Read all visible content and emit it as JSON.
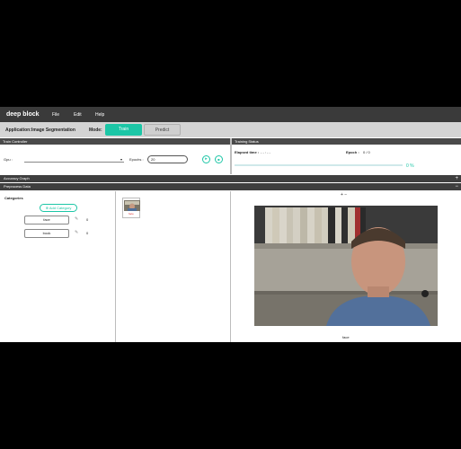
{
  "app": {
    "brand": "deep block",
    "menu": [
      "File",
      "Edit",
      "Help"
    ]
  },
  "modebar": {
    "application_label": "Application:",
    "application_value": "Image Segmentation",
    "mode_label": "Mode:",
    "train_label": "Train",
    "predict_label": "Predict"
  },
  "train_controller": {
    "title": "Train Controller",
    "gpu_label": "Gpu :",
    "epochs_label": "Epochs :",
    "epochs_value": "20"
  },
  "training_status": {
    "title": "Training Status",
    "elapsed_label": "Elapsed time :",
    "elapsed_value": "- - : - -",
    "epoch_label": "Epoch :",
    "epoch_value": "0 / 0",
    "progress_text": "0 %",
    "progress_value": 0
  },
  "sections": {
    "accuracy_graph": "Accuracy Graph",
    "preprocess_data": "Preprocess Data"
  },
  "categories": {
    "title": "Categories",
    "add_label": "Add Category",
    "items": [
      {
        "name": "face",
        "count": "0"
      },
      {
        "name": "book",
        "count": "0"
      }
    ]
  },
  "thumbnail": {
    "label": "face"
  },
  "viewer": {
    "zoom_controls": "+ −",
    "caption": "face"
  },
  "colors": {
    "accent": "#1cc6a6",
    "header_dark": "#3a3a3a",
    "mode_bar": "#d4d4d4"
  }
}
